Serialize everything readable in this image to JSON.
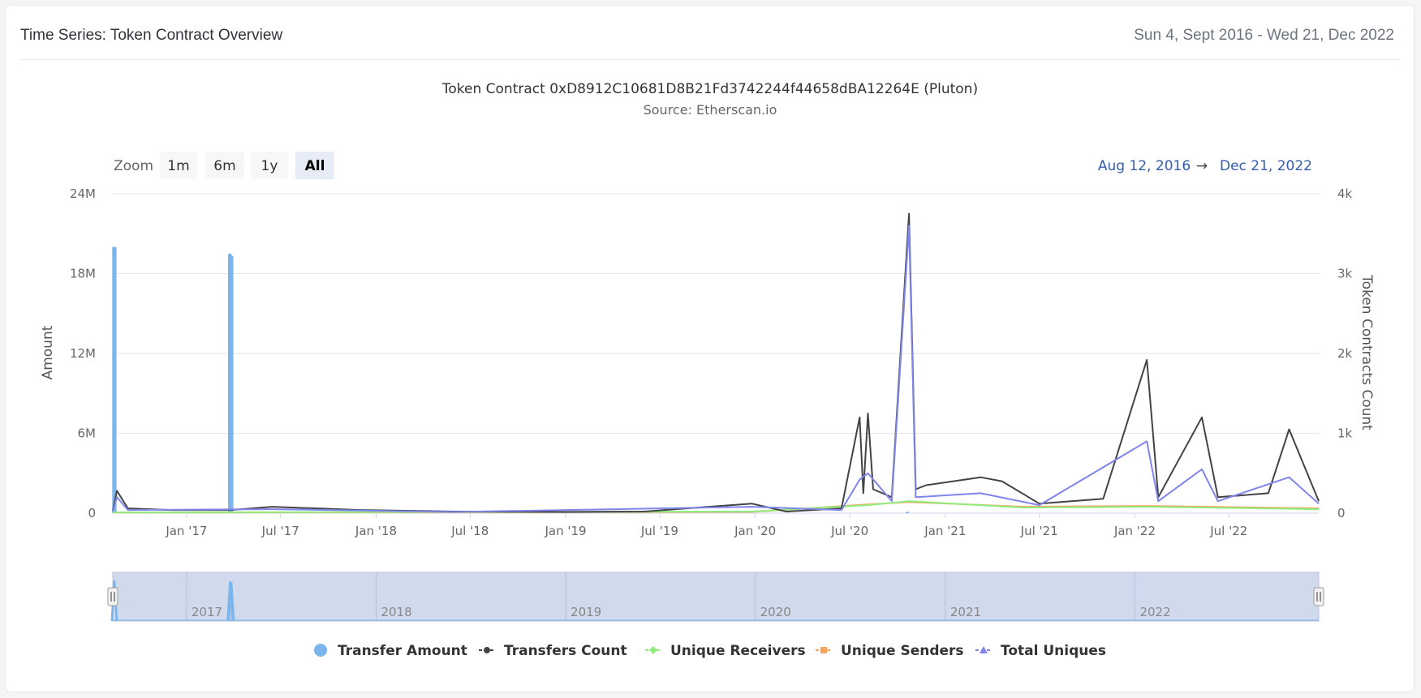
{
  "card": {
    "title": "Time Series: Token Contract Overview",
    "date_range": "Sun 4, Sept 2016 - Wed 21, Dec 2022"
  },
  "chart": {
    "title": "Token Contract 0xD8912C10681D8B21Fd3742244f44658dBA12264E (Pluton)",
    "subtitle": "Source: Etherscan.io",
    "zoom_label": "Zoom",
    "zoom_buttons": [
      "1m",
      "6m",
      "1y",
      "All"
    ],
    "zoom_selected": "All",
    "range_from": "Aug 12, 2016",
    "range_arrow": "→",
    "range_to": "Dec 21, 2022",
    "navigator_labels": [
      "2017",
      "2018",
      "2019",
      "2020",
      "2021",
      "2022"
    ]
  },
  "chart_data": {
    "type": "area",
    "x_range": [
      "2016-08-12",
      "2022-12-21"
    ],
    "x_tick_labels": [
      "Jan '17",
      "Jul '17",
      "Jan '18",
      "Jul '18",
      "Jan '19",
      "Jul '19",
      "Jan '20",
      "Jul '20",
      "Jan '21",
      "Jul '21",
      "Jan '22",
      "Jul '22"
    ],
    "y_left": {
      "label": "Amount",
      "ticks": [
        "0",
        "6M",
        "12M",
        "18M",
        "24M"
      ],
      "range": [
        0,
        24000000
      ]
    },
    "y_right": {
      "label": "Token Contracts Count",
      "ticks": [
        "0",
        "1k",
        "2k",
        "3k",
        "4k"
      ],
      "range": [
        0,
        4000
      ]
    },
    "legend_position": "bottom",
    "colors": {
      "transfer_amount": "#7cb5ec",
      "transfers_count": "#434348",
      "unique_receivers": "#90ed7d",
      "unique_senders": "#f7a35c",
      "total_uniques": "#8085e9"
    },
    "series": [
      {
        "name": "Transfer Amount",
        "axis": "left",
        "points": [
          [
            "2016-08-14",
            20000000
          ],
          [
            "2016-08-15",
            20000000
          ],
          [
            "2016-08-16",
            20000000
          ],
          [
            "2017-03-25",
            19500000
          ],
          [
            "2017-03-27",
            19400000
          ],
          [
            "2017-03-29",
            19300000
          ],
          [
            "2020-10-20",
            100000
          ]
        ]
      },
      {
        "name": "Transfers Count",
        "axis": "right",
        "points": [
          [
            "2016-08-12",
            30
          ],
          [
            "2016-08-20",
            280
          ],
          [
            "2016-09-10",
            60
          ],
          [
            "2016-12-01",
            40
          ],
          [
            "2017-03-27",
            40
          ],
          [
            "2017-06-15",
            80
          ],
          [
            "2017-12-01",
            40
          ],
          [
            "2018-06-01",
            20
          ],
          [
            "2019-01-01",
            15
          ],
          [
            "2019-06-01",
            20
          ],
          [
            "2019-12-25",
            120
          ],
          [
            "2020-03-01",
            20
          ],
          [
            "2020-06-15",
            60
          ],
          [
            "2020-07-20",
            1200
          ],
          [
            "2020-07-27",
            250
          ],
          [
            "2020-08-05",
            1250
          ],
          [
            "2020-08-15",
            300
          ],
          [
            "2020-09-20",
            200
          ],
          [
            "2020-10-23",
            3750
          ],
          [
            "2020-11-05",
            300
          ],
          [
            "2020-11-25",
            350
          ],
          [
            "2021-03-10",
            450
          ],
          [
            "2021-04-20",
            400
          ],
          [
            "2021-07-01",
            120
          ],
          [
            "2021-11-01",
            180
          ],
          [
            "2022-01-24",
            1920
          ],
          [
            "2022-02-15",
            200
          ],
          [
            "2022-05-10",
            1200
          ],
          [
            "2022-06-10",
            200
          ],
          [
            "2022-09-15",
            250
          ],
          [
            "2022-10-25",
            1050
          ],
          [
            "2022-12-21",
            150
          ]
        ]
      },
      {
        "name": "Unique Receivers",
        "axis": "right",
        "points": [
          [
            "2016-08-12",
            10
          ],
          [
            "2019-12-25",
            20
          ],
          [
            "2020-08-05",
            100
          ],
          [
            "2020-10-23",
            150
          ],
          [
            "2021-06-01",
            70
          ],
          [
            "2022-01-24",
            80
          ],
          [
            "2022-12-21",
            50
          ]
        ]
      },
      {
        "name": "Unique Senders",
        "axis": "right",
        "points": [
          [
            "2016-08-12",
            8
          ],
          [
            "2019-12-25",
            15
          ],
          [
            "2020-08-05",
            110
          ],
          [
            "2020-10-23",
            140
          ],
          [
            "2021-06-01",
            80
          ],
          [
            "2022-01-24",
            90
          ],
          [
            "2022-12-21",
            60
          ]
        ]
      },
      {
        "name": "Total Uniques",
        "axis": "right",
        "points": [
          [
            "2016-08-12",
            20
          ],
          [
            "2016-08-20",
            200
          ],
          [
            "2016-09-10",
            40
          ],
          [
            "2017-06-15",
            50
          ],
          [
            "2018-06-01",
            15
          ],
          [
            "2019-12-25",
            80
          ],
          [
            "2020-06-15",
            40
          ],
          [
            "2020-07-20",
            420
          ],
          [
            "2020-08-05",
            500
          ],
          [
            "2020-09-20",
            150
          ],
          [
            "2020-10-23",
            3600
          ],
          [
            "2020-11-05",
            200
          ],
          [
            "2021-03-10",
            250
          ],
          [
            "2021-07-01",
            100
          ],
          [
            "2022-01-24",
            900
          ],
          [
            "2022-02-15",
            150
          ],
          [
            "2022-05-10",
            550
          ],
          [
            "2022-06-10",
            150
          ],
          [
            "2022-10-25",
            450
          ],
          [
            "2022-12-21",
            120
          ]
        ]
      }
    ]
  }
}
